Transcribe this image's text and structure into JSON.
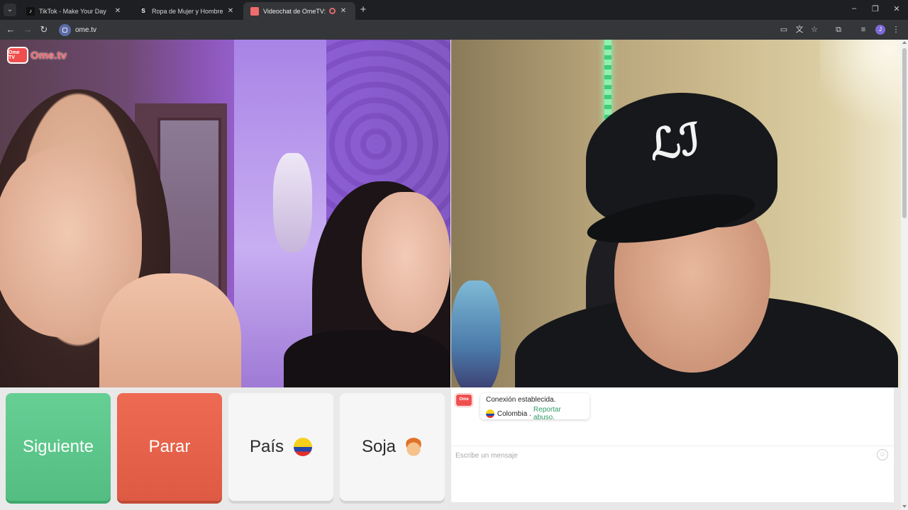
{
  "browser": {
    "tabs": [
      {
        "title": "TikTok - Make Your Day",
        "favicon": "tiktok-icon",
        "active": false
      },
      {
        "title": "Ropa de Mujer y Hombre, Com",
        "favicon": "shein-icon",
        "active": false
      },
      {
        "title": "Videochat de OmeTV: una",
        "favicon": "ometv-icon",
        "active": true,
        "recording": true
      }
    ],
    "address": "ome.tv",
    "profile_initial": "J"
  },
  "site": {
    "logo_badge": "Ome TV",
    "logo_text": "Ome.tv",
    "accent": "#f04e4e"
  },
  "controls": {
    "next_label": "Siguiente",
    "stop_label": "Parar",
    "country_label": "País",
    "country_flag": "colombia-flag-icon",
    "gender_label": "Soja",
    "gender_icon": "boy-emoji-icon",
    "next_color": "#5ec88c",
    "stop_color": "#e6634b"
  },
  "chat": {
    "system_logo": "Ome TV",
    "status": "Conexión establecida.",
    "country": "Colombia",
    "separator": ".",
    "report_link": "Reportar abuso.",
    "input_placeholder": "Escribe un mensaje"
  }
}
